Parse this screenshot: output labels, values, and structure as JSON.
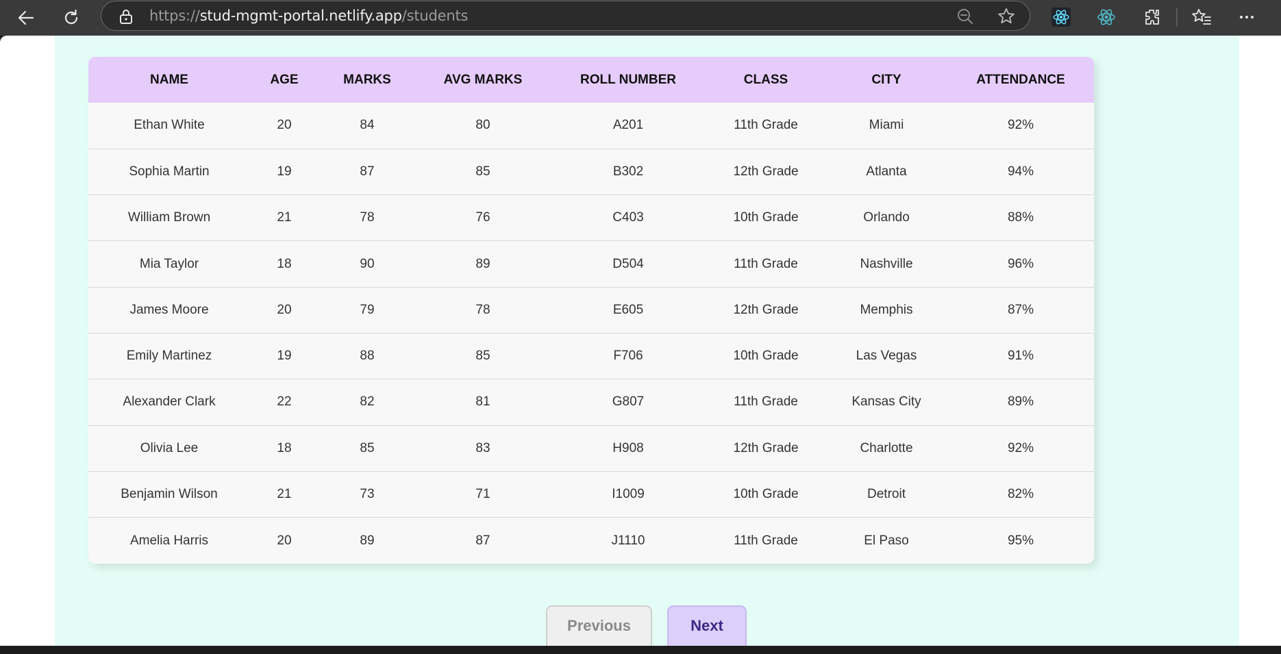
{
  "browser": {
    "url_scheme": "https://",
    "url_host": "stud-mgmt-portal.netlify.app",
    "url_path": "/students",
    "icons": [
      "back-arrow-icon",
      "refresh-icon",
      "lock-icon",
      "zoom-out-icon",
      "favorite-star-icon",
      "react-devtools-icon",
      "redux-devtools-icon",
      "extensions-icon",
      "favorites-icon",
      "more-menu-icon"
    ]
  },
  "table": {
    "headers": [
      "NAME",
      "AGE",
      "MARKS",
      "AVG MARKS",
      "ROLL NUMBER",
      "CLASS",
      "CITY",
      "ATTENDANCE"
    ],
    "rows": [
      [
        "Ethan White",
        "20",
        "84",
        "80",
        "A201",
        "11th Grade",
        "Miami",
        "92%"
      ],
      [
        "Sophia Martin",
        "19",
        "87",
        "85",
        "B302",
        "12th Grade",
        "Atlanta",
        "94%"
      ],
      [
        "William Brown",
        "21",
        "78",
        "76",
        "C403",
        "10th Grade",
        "Orlando",
        "88%"
      ],
      [
        "Mia Taylor",
        "18",
        "90",
        "89",
        "D504",
        "11th Grade",
        "Nashville",
        "96%"
      ],
      [
        "James Moore",
        "20",
        "79",
        "78",
        "E605",
        "12th Grade",
        "Memphis",
        "87%"
      ],
      [
        "Emily Martinez",
        "19",
        "88",
        "85",
        "F706",
        "10th Grade",
        "Las Vegas",
        "91%"
      ],
      [
        "Alexander Clark",
        "22",
        "82",
        "81",
        "G807",
        "11th Grade",
        "Kansas City",
        "89%"
      ],
      [
        "Olivia Lee",
        "18",
        "85",
        "83",
        "H908",
        "12th Grade",
        "Charlotte",
        "92%"
      ],
      [
        "Benjamin Wilson",
        "21",
        "73",
        "71",
        "I1009",
        "10th Grade",
        "Detroit",
        "82%"
      ],
      [
        "Amelia Harris",
        "20",
        "89",
        "87",
        "J1110",
        "11th Grade",
        "El Paso",
        "95%"
      ]
    ]
  },
  "pagination": {
    "previous_label": "Previous",
    "next_label": "Next"
  },
  "colors": {
    "page_background": "#e3fdf6",
    "header_background": "#e6ccfb",
    "next_button": "#dcd0fb"
  }
}
